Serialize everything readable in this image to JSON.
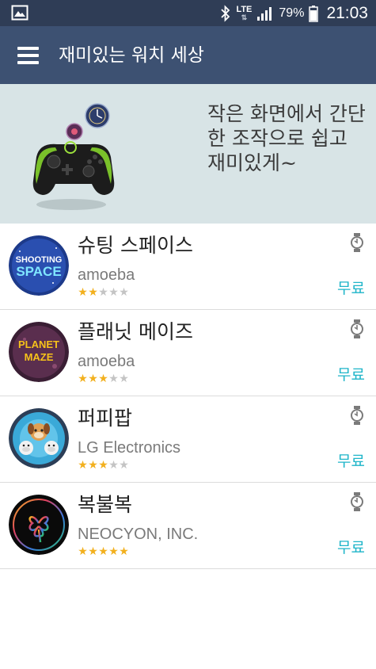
{
  "status_bar": {
    "network": "LTE",
    "battery": "79%",
    "time": "21:03"
  },
  "header": {
    "title": "재미있는 워치 세상"
  },
  "banner": {
    "text": "작은 화면에서 간단한 조작으로 쉽고 재미있게~"
  },
  "apps": [
    {
      "name": "슈팅 스페이스",
      "developer": "amoeba",
      "rating": 2,
      "price": "무료",
      "icon_lines": [
        "SHOOTING",
        "SPACE"
      ]
    },
    {
      "name": "플래닛 메이즈",
      "developer": "amoeba",
      "rating": 3,
      "price": "무료",
      "icon_lines": [
        "PLANET",
        "MAZE"
      ]
    },
    {
      "name": "퍼피팝",
      "developer": "LG Electronics",
      "rating": 3,
      "price": "무료",
      "icon_lines": []
    },
    {
      "name": "복불복",
      "developer": "NEOCYON, INC.",
      "rating": 5,
      "price": "무료",
      "icon_lines": []
    }
  ],
  "colors": {
    "status_bar": "#2f3d56",
    "app_bar": "#3d5172",
    "banner_bg": "#d8e4e6",
    "price": "#1fb5c9",
    "star_on": "#f2b01e",
    "star_off": "#c4c4c4"
  }
}
